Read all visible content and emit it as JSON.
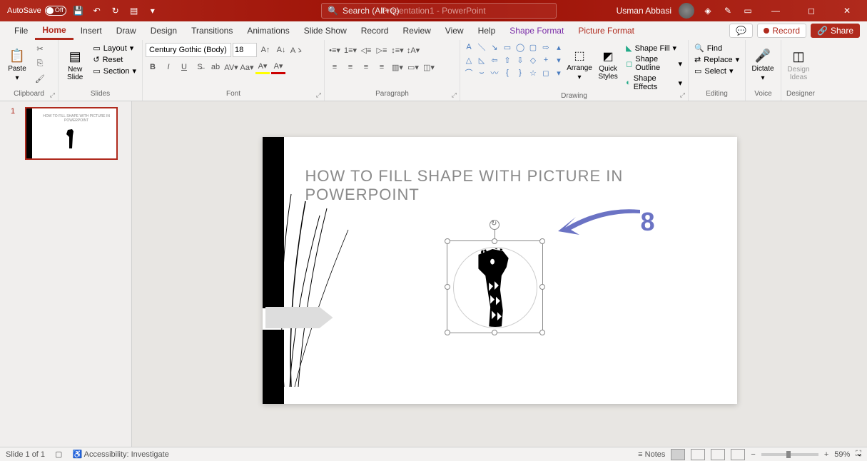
{
  "titlebar": {
    "autosave_label": "AutoSave",
    "autosave_state": "Off",
    "doc_title": "Presentation1 - PowerPoint",
    "search_placeholder": "Search (Alt+Q)",
    "user_name": "Usman Abbasi"
  },
  "tabs": {
    "file": "File",
    "home": "Home",
    "insert": "Insert",
    "draw": "Draw",
    "design": "Design",
    "transitions": "Transitions",
    "animations": "Animations",
    "slideshow": "Slide Show",
    "record": "Record",
    "review": "Review",
    "view": "View",
    "help": "Help",
    "shape_format": "Shape Format",
    "picture_format": "Picture Format",
    "record_btn": "Record",
    "share_btn": "Share"
  },
  "ribbon": {
    "clipboard": {
      "paste": "Paste",
      "label": "Clipboard"
    },
    "slides": {
      "new_slide": "New\nSlide",
      "layout": "Layout",
      "reset": "Reset",
      "section": "Section",
      "label": "Slides"
    },
    "font": {
      "name": "Century Gothic (Body)",
      "size": "18",
      "label": "Font"
    },
    "paragraph": {
      "label": "Paragraph"
    },
    "drawing": {
      "arrange": "Arrange",
      "quick_styles": "Quick\nStyles",
      "shape_fill": "Shape Fill",
      "shape_outline": "Shape Outline",
      "shape_effects": "Shape Effects",
      "label": "Drawing"
    },
    "editing": {
      "find": "Find",
      "replace": "Replace",
      "select": "Select",
      "label": "Editing"
    },
    "voice": {
      "dictate": "Dictate",
      "label": "Voice"
    },
    "designer": {
      "design_ideas": "Design\nIdeas",
      "label": "Designer"
    }
  },
  "slide_panel": {
    "slide_num": "1"
  },
  "slide": {
    "title": "HOW TO FILL SHAPE WITH PICTURE IN POWERPOINT",
    "annotation_number": "8"
  },
  "status": {
    "slide_info": "Slide 1 of 1",
    "accessibility": "Accessibility: Investigate",
    "notes": "Notes",
    "zoom": "59%"
  }
}
